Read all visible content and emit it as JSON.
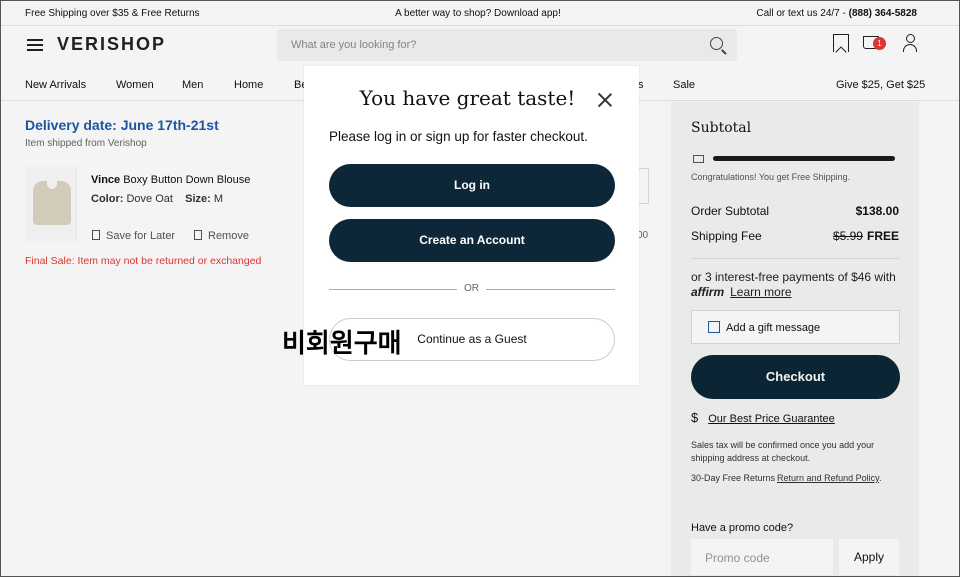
{
  "promo_bar": {
    "left": "Free Shipping over $35 & Free Returns",
    "center": "A better way to shop? Download app!",
    "right_prefix": "Call or text us 24/7 - ",
    "phone": "(888) 364-5828"
  },
  "header": {
    "logo": "VERISHOP",
    "search_placeholder": "What are you looking for?",
    "cart_count": "1"
  },
  "nav": {
    "items": [
      "New Arrivals",
      "Women",
      "Men",
      "Home",
      "Be",
      "s",
      "Sale"
    ],
    "promo": "Give $25, Get $25"
  },
  "cart": {
    "delivery": "Delivery date: June 17th-21st",
    "shipped_from": "Item shipped from Verishop",
    "item": {
      "brand": "Vince",
      "name": "Boxy Button Down Blouse",
      "color_label": "Color:",
      "color": "Dove Oat",
      "size_label": "Size:",
      "size": "M",
      "save_for_later": "Save for Later",
      "remove": "Remove",
      "price_edge": "00"
    },
    "final_sale": "Final Sale: Item may not be returned or exchanged"
  },
  "summary": {
    "title": "Subtotal",
    "shipping_note": "Congratulations! You get Free Shipping.",
    "order_subtotal_label": "Order Subtotal",
    "order_subtotal": "$138.00",
    "shipping_fee_label": "Shipping Fee",
    "shipping_fee_old": "$5.99",
    "shipping_fee_new": "FREE",
    "installments": "or 3 interest-free payments of $46 with",
    "affirm": "affirm",
    "learn_more": "Learn more",
    "gift_message": "Add a gift message",
    "checkout": "Checkout",
    "price_guarantee_symbol": "$",
    "price_guarantee": "Our Best Price Guarantee",
    "tax_note": "Sales tax will be confirmed once you add your shipping address at checkout.",
    "returns_prefix": "30-Day Free Returns",
    "returns_link": "Return and Refund Policy",
    "returns_suffix": ".",
    "promo_label": "Have a promo code?",
    "promo_placeholder": "Promo code",
    "apply": "Apply"
  },
  "modal": {
    "title": "You have great taste!",
    "subtitle": "Please log in or sign up for faster checkout.",
    "login": "Log in",
    "create_account": "Create an Account",
    "or": "OR",
    "guest": "Continue as a Guest",
    "korean_annotation": "비회원구매"
  }
}
